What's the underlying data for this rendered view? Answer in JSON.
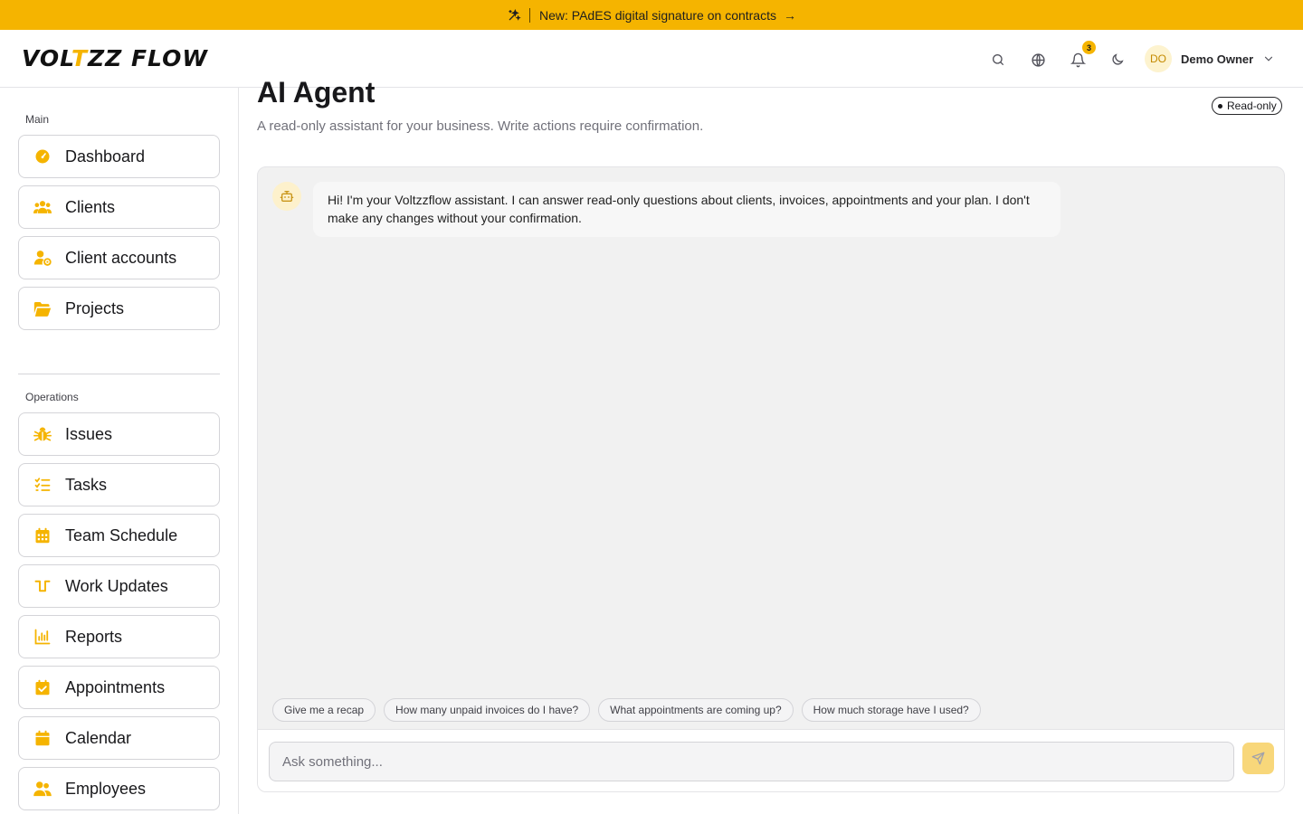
{
  "banner": {
    "text": "New: PAdES digital signature on contracts",
    "arrow": "→"
  },
  "header": {
    "logo_pre": "VOL",
    "logo_accent": "T",
    "logo_post": "ZZ FLOW",
    "notifications_count": "3",
    "user": {
      "initials": "DO",
      "name": "Demo Owner"
    }
  },
  "sidebar": {
    "sections": [
      {
        "label": "Main",
        "items": [
          {
            "label": "Dashboard",
            "icon": "gauge-icon"
          },
          {
            "label": "Clients",
            "icon": "users-icon"
          },
          {
            "label": "Client accounts",
            "icon": "user-cog-icon"
          },
          {
            "label": "Projects",
            "icon": "folder-open-icon"
          }
        ]
      },
      {
        "label": "Operations",
        "items": [
          {
            "label": "Issues",
            "icon": "bug-icon"
          },
          {
            "label": "Tasks",
            "icon": "list-checks-icon"
          },
          {
            "label": "Team Schedule",
            "icon": "calendar-grid-icon"
          },
          {
            "label": "Work Updates",
            "icon": "activity-icon"
          },
          {
            "label": "Reports",
            "icon": "bar-chart-icon"
          },
          {
            "label": "Appointments",
            "icon": "calendar-check-icon"
          },
          {
            "label": "Calendar",
            "icon": "calendar-icon"
          },
          {
            "label": "Employees",
            "icon": "users-icon"
          }
        ]
      }
    ]
  },
  "main": {
    "title": "AI Agent",
    "subtitle": "A read-only assistant for your business. Write actions require confirmation.",
    "badge": "Read-only"
  },
  "chat": {
    "messages": [
      {
        "role": "assistant",
        "text": "Hi! I'm your Voltzzflow assistant. I can answer read-only questions about clients, invoices, appointments and your plan. I don't make any changes without your confirmation."
      }
    ],
    "suggestions": [
      "Give me a recap",
      "How many unpaid invoices do I have?",
      "What appointments are coming up?",
      "How much storage have I used?"
    ],
    "input": {
      "placeholder": "Ask something...",
      "value": ""
    }
  },
  "colors": {
    "accent": "#f5b400",
    "accent_soft": "#f8d77a",
    "border": "#d4d4d8",
    "chat_bg": "#f1f1f1"
  }
}
